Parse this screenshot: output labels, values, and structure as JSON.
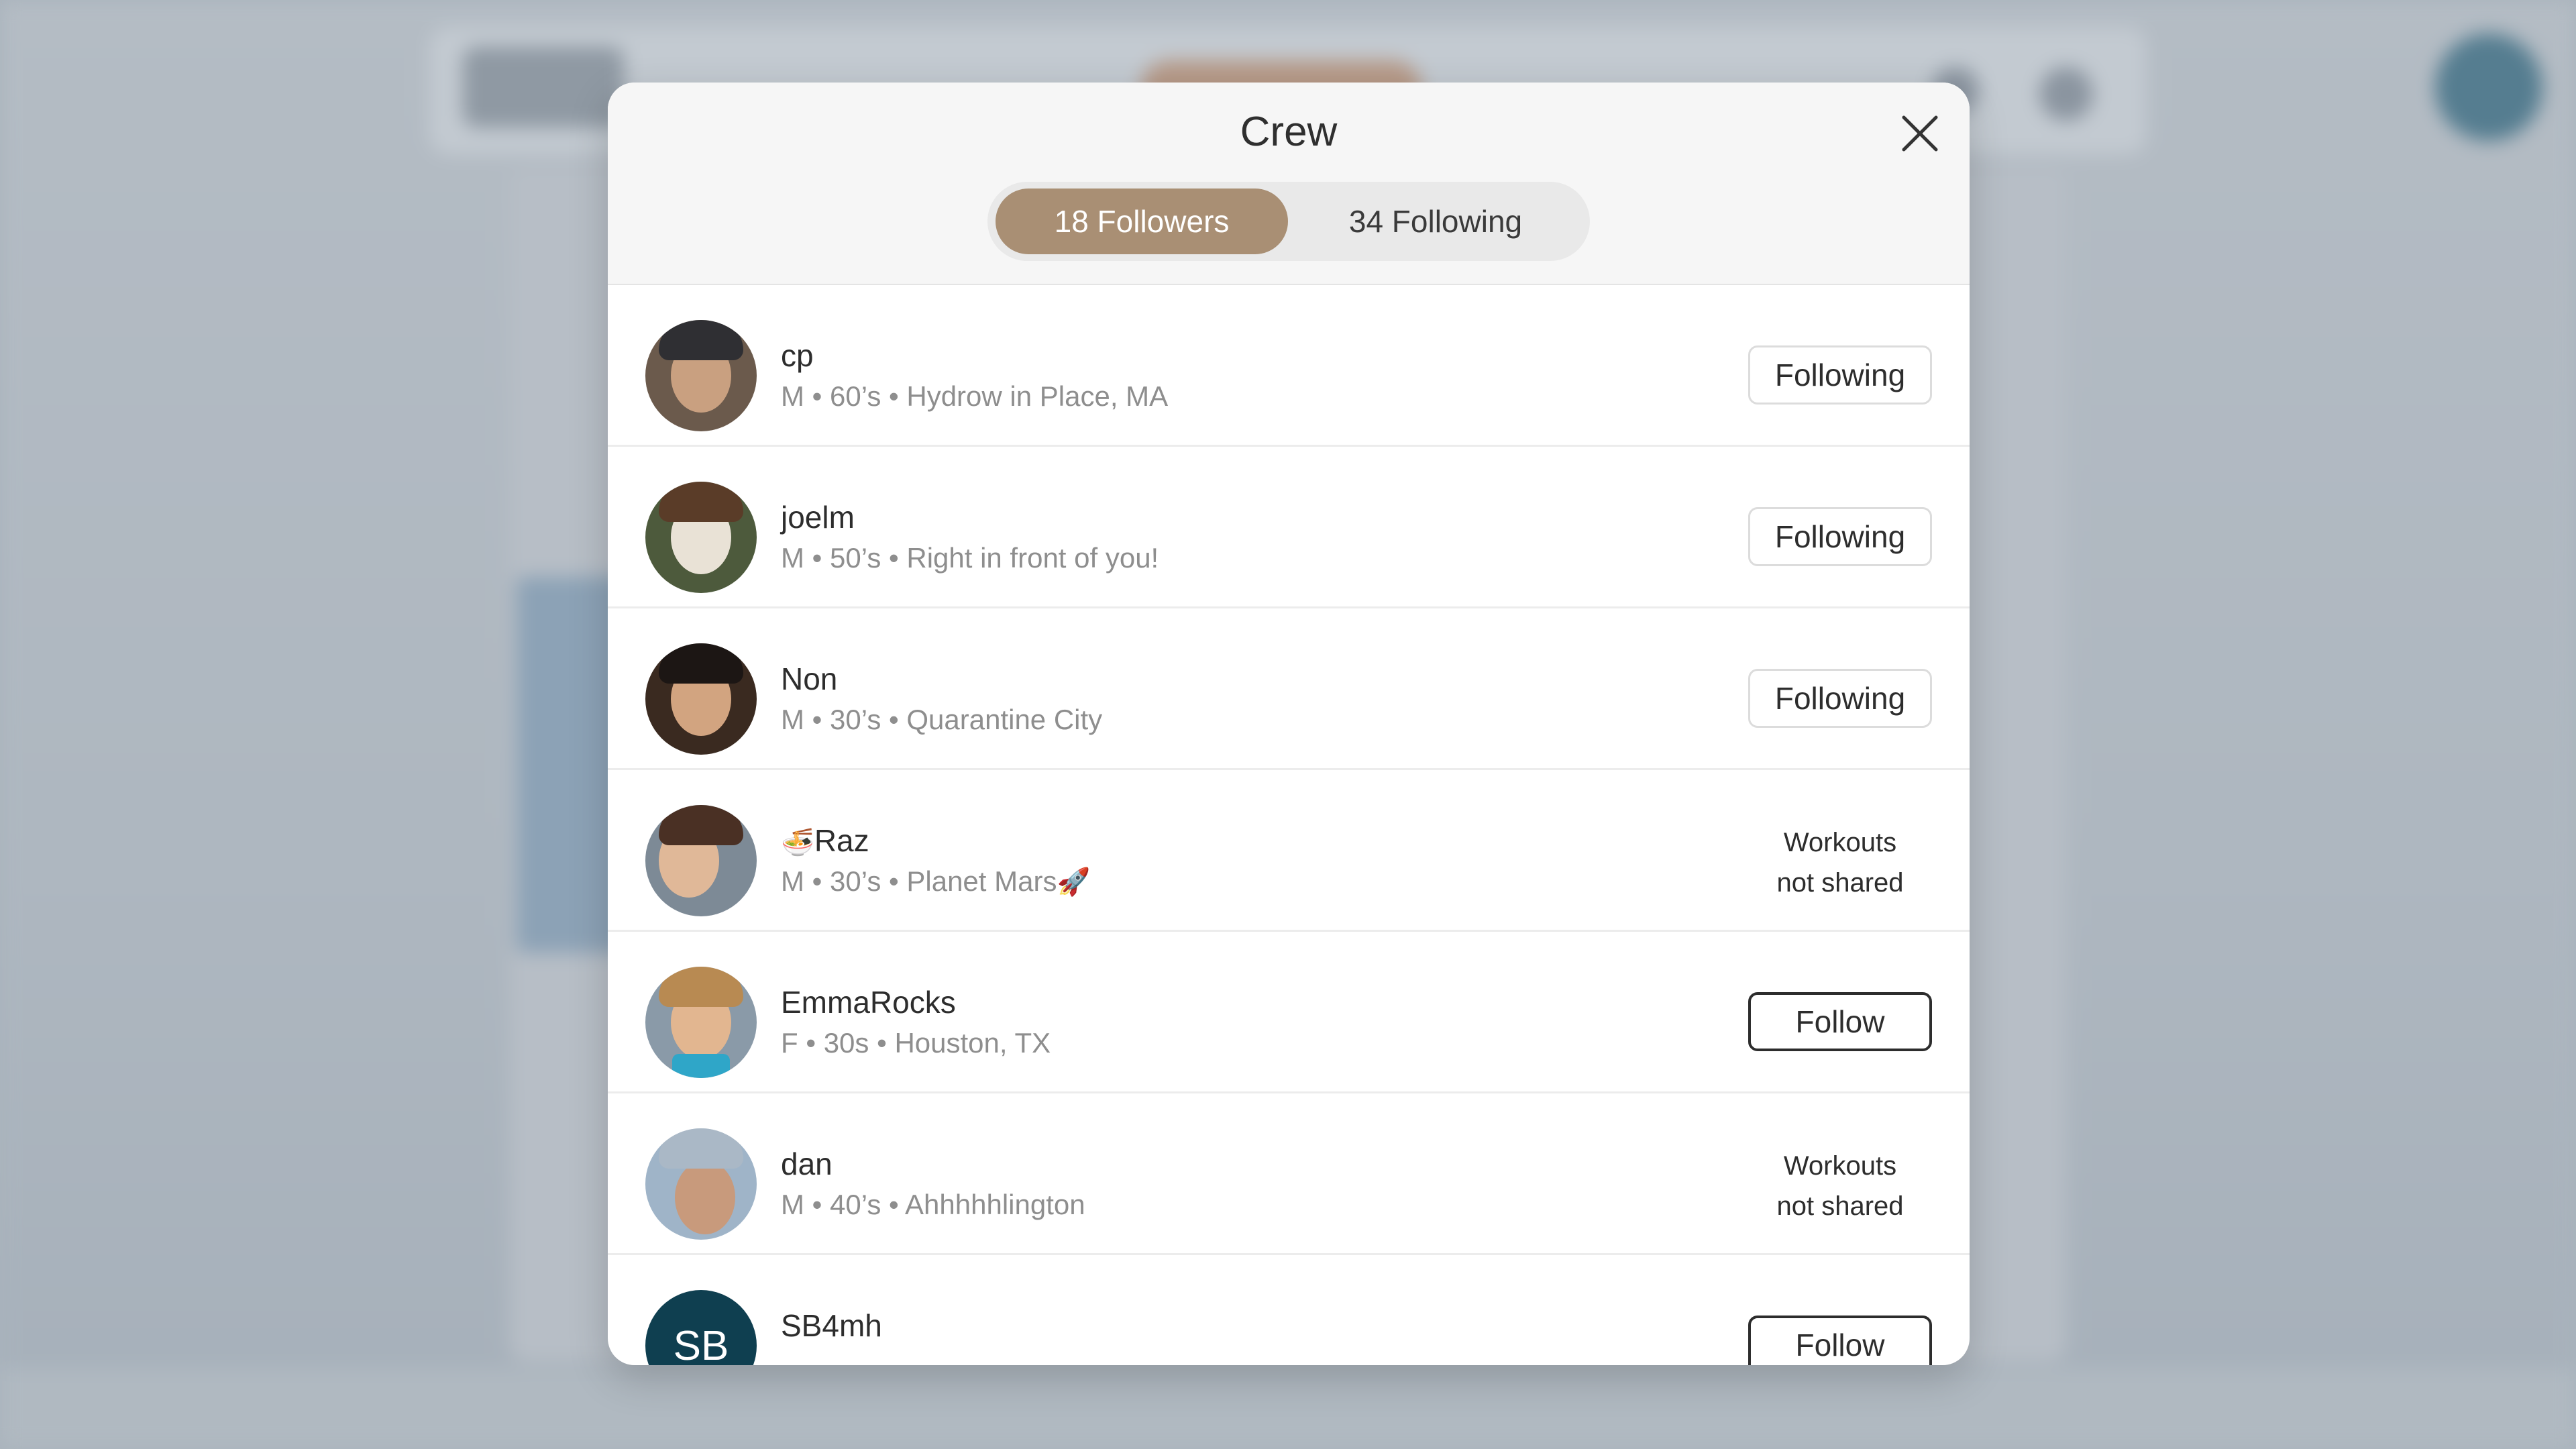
{
  "modal": {
    "title": "Crew",
    "tabs": [
      {
        "label": "18 Followers",
        "active": true
      },
      {
        "label": "34 Following",
        "active": false
      }
    ]
  },
  "users": [
    {
      "username": "cp",
      "meta": "M • 60’s • Hydrow in Place, MA",
      "action": "Following"
    },
    {
      "username": "joelm",
      "meta": "M • 50’s • Right in front of you!",
      "action": "Following"
    },
    {
      "username": "Non",
      "meta": "M • 30’s • Quarantine City",
      "action": "Following"
    },
    {
      "username": "Raz",
      "username_prefix_emoji": "🍜",
      "meta": "M • 30’s • Planet Mars",
      "meta_suffix_emoji": "🚀",
      "action_line1": "Workouts",
      "action_line2": "not shared"
    },
    {
      "username": "EmmaRocks",
      "meta": "F • 30s • Houston, TX",
      "action": "Follow"
    },
    {
      "username": "dan",
      "meta": "M • 40’s • Ahhhhhlington",
      "action_line1": "Workouts",
      "action_line2": "not shared"
    },
    {
      "username": "SB4mh",
      "initials": "SB",
      "action": "Follow"
    }
  ],
  "colors": {
    "accent": "#a98f74",
    "initials_bg": "#0f3f50"
  }
}
